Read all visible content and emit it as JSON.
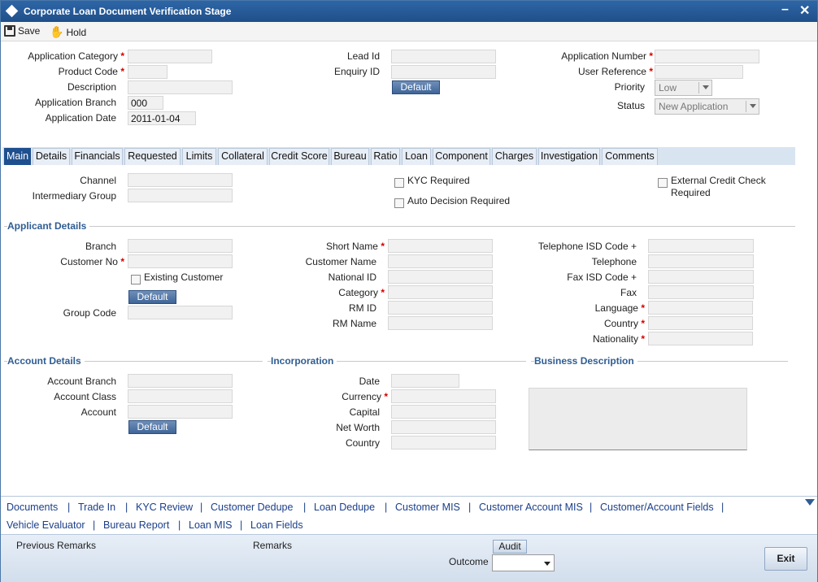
{
  "window": {
    "title": "Corporate Loan Document Verification Stage",
    "minimize": "–",
    "close": "✕"
  },
  "toolbar": {
    "save_label": "Save",
    "hold_label": "Hold",
    "hold_icon": "✋"
  },
  "header": {
    "application_category": {
      "label": "Application Category",
      "value": ""
    },
    "product_code": {
      "label": "Product Code",
      "value": ""
    },
    "description": {
      "label": "Description",
      "value": ""
    },
    "application_branch": {
      "label": "Application Branch",
      "value": "000"
    },
    "application_date": {
      "label": "Application Date",
      "value": "2011-01-04"
    },
    "lead_id": {
      "label": "Lead Id",
      "value": ""
    },
    "enquiry_id": {
      "label": "Enquiry ID",
      "value": ""
    },
    "default_label": "Default",
    "application_number": {
      "label": "Application Number",
      "value": ""
    },
    "user_reference": {
      "label": "User Reference",
      "value": ""
    },
    "priority": {
      "label": "Priority",
      "value": "Low"
    },
    "status": {
      "label": "Status",
      "value": "New Application"
    },
    "required_mark": "*"
  },
  "tabs": [
    "Main",
    "Details",
    "Financials",
    "Requested",
    "Limits",
    "Collateral",
    "Credit Score",
    "Bureau",
    "Ratio",
    "Loan",
    "Component",
    "Charges",
    "Investigation",
    "Comments"
  ],
  "main": {
    "channel": "Channel",
    "intermediary_group": "Intermediary Group",
    "kyc_required": "KYC Required",
    "auto_decision_required": "Auto Decision Required",
    "external_credit_check_1": "External Credit Check",
    "external_credit_check_2": "Required",
    "applicant_details": "Applicant Details",
    "branch": "Branch",
    "customer_no": "Customer No",
    "existing_customer": "Existing Customer",
    "default_label": "Default",
    "group_code": "Group Code",
    "short_name": "Short Name",
    "customer_name": "Customer Name",
    "national_id": "National ID",
    "category": "Category",
    "rm_id": "RM ID",
    "rm_name": "RM Name",
    "telephone_isd": "Telephone ISD Code +",
    "telephone": "Telephone",
    "fax_isd": "Fax ISD Code +",
    "fax": "Fax",
    "language": "Language",
    "country": "Country",
    "nationality": "Nationality",
    "account_details": "Account Details",
    "account_branch": "Account Branch",
    "account_class": "Account Class",
    "account": "Account",
    "incorporation": "Incorporation",
    "inc_date": "Date",
    "inc_currency": "Currency",
    "inc_capital": "Capital",
    "inc_net_worth": "Net Worth",
    "inc_country": "Country",
    "business_description": "Business Description"
  },
  "links": {
    "row1": [
      "Documents",
      "Trade In",
      "KYC Review",
      "Customer Dedupe",
      "Loan Dedupe",
      "Customer MIS",
      "Customer Account MIS",
      "Customer/Account Fields"
    ],
    "row2": [
      "Vehicle Evaluator",
      "Bureau Report",
      "Loan MIS",
      "Loan Fields"
    ],
    "separator": "|"
  },
  "footer": {
    "previous_remarks": "Previous Remarks",
    "remarks": "Remarks",
    "audit": "Audit",
    "outcome": "Outcome",
    "outcome_value": "",
    "exit": "Exit"
  }
}
